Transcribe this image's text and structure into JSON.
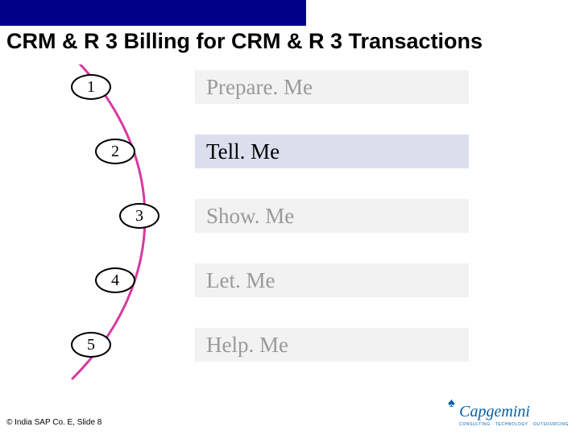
{
  "title": "CRM & R 3 Billing for CRM & R 3 Transactions",
  "steps": [
    {
      "num": "1",
      "label": "Prepare. Me"
    },
    {
      "num": "2",
      "label": "Tell. Me"
    },
    {
      "num": "3",
      "label": "Show. Me"
    },
    {
      "num": "4",
      "label": "Let. Me"
    },
    {
      "num": "5",
      "label": "Help. Me"
    }
  ],
  "footer": "© India SAP Co. E, Slide 8",
  "logo": {
    "name": "Capgemini",
    "tagline": "CONSULTING · TECHNOLOGY · OUTSOURCING"
  }
}
